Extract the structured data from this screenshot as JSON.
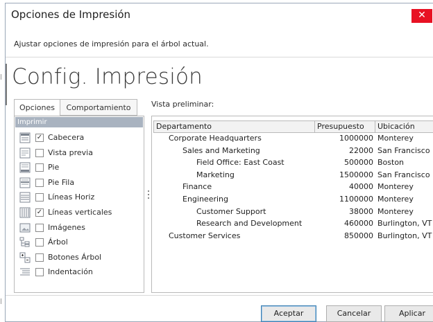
{
  "window": {
    "title": "Opciones de Impresión",
    "close_glyph": "✕",
    "description": "Ajustar opciones de impresión para el árbol actual."
  },
  "header": {
    "title": "Config. Impresión"
  },
  "tabs": [
    {
      "label": "Opciones",
      "active": true
    },
    {
      "label": "Comportamiento",
      "active": false
    }
  ],
  "options_group": {
    "header": "Imprimir",
    "items": [
      {
        "label": "Cabecera",
        "checked": true,
        "icon": "header-icon"
      },
      {
        "label": "Vista previa",
        "checked": false,
        "icon": "preview-icon"
      },
      {
        "label": "Pie",
        "checked": false,
        "icon": "footer-icon"
      },
      {
        "label": "Pie Fila",
        "checked": false,
        "icon": "row-footer-icon"
      },
      {
        "label": "Líneas Horiz",
        "checked": false,
        "icon": "horizontal-lines-icon"
      },
      {
        "label": "Líneas verticales",
        "checked": true,
        "icon": "vertical-lines-icon"
      },
      {
        "label": "Imágenes",
        "checked": false,
        "icon": "images-icon"
      },
      {
        "label": "Árbol",
        "checked": false,
        "icon": "tree-icon"
      },
      {
        "label": "Botones Árbol",
        "checked": false,
        "icon": "tree-buttons-icon"
      },
      {
        "label": "Indentación",
        "checked": false,
        "icon": "indent-icon"
      }
    ]
  },
  "preview": {
    "label": "Vista preliminar:",
    "columns": [
      "Departamento",
      "Presupuesto",
      "Ubicación"
    ],
    "rows": [
      {
        "department": "Corporate Headquarters",
        "budget": "1000000",
        "location": "Monterey",
        "level": 0
      },
      {
        "department": "Sales and Marketing",
        "budget": "22000",
        "location": "San Francisco",
        "level": 1
      },
      {
        "department": "Field Office: East Coast",
        "budget": "500000",
        "location": "Boston",
        "level": 2
      },
      {
        "department": "Marketing",
        "budget": "1500000",
        "location": "San Francisco",
        "level": 2
      },
      {
        "department": "Finance",
        "budget": "40000",
        "location": "Monterey",
        "level": 1
      },
      {
        "department": "Engineering",
        "budget": "1100000",
        "location": "Monterey",
        "level": 1
      },
      {
        "department": "Customer Support",
        "budget": "38000",
        "location": "Monterey",
        "level": 2
      },
      {
        "department": "Research and Development",
        "budget": "460000",
        "location": "Burlington, VT",
        "level": 2
      },
      {
        "department": "Customer Services",
        "budget": "850000",
        "location": "Burlington, VT",
        "level": 0
      }
    ]
  },
  "buttons": {
    "accept": "Aceptar",
    "cancel": "Cancelar",
    "apply": "Aplicar"
  },
  "colors": {
    "close": "#e81123",
    "group_header": "#a9b3c0",
    "accent": "#3c7fb1"
  }
}
